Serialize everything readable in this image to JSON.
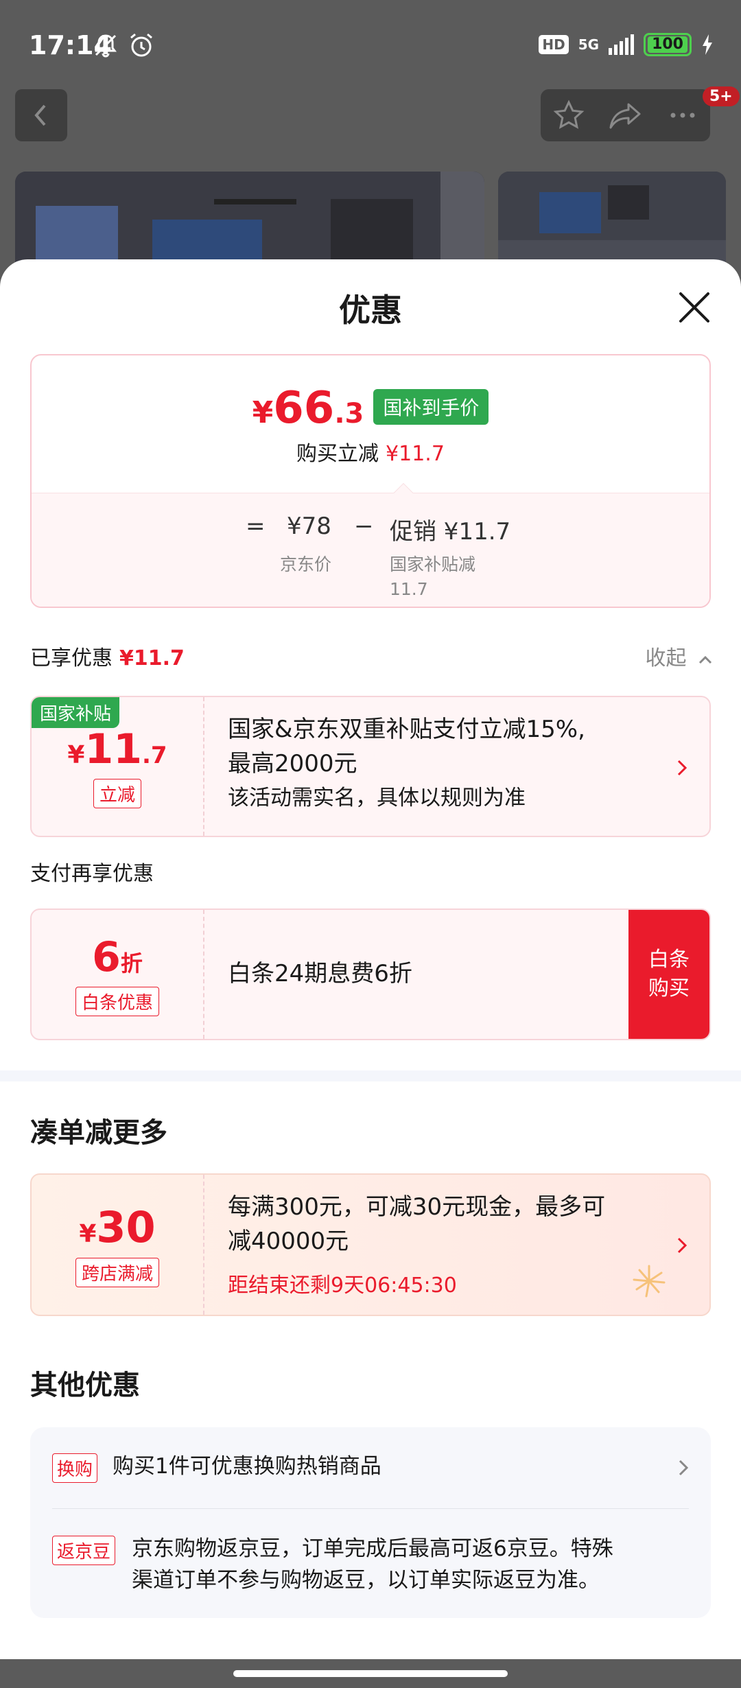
{
  "status_bar": {
    "time": "17:14",
    "hd": "HD",
    "network": "5G",
    "battery": "100"
  },
  "top_bar": {
    "cart_badge": "5+"
  },
  "sheet": {
    "title": "优惠",
    "price_card": {
      "yen": "¥",
      "final_int": "66",
      "final_dec": ".3",
      "final_tag": "国补到手价",
      "instant_label": "购买立减",
      "instant_value": "¥11.7",
      "equals": "=",
      "jd_price": "¥78",
      "minus": "−",
      "promo": "促销 ¥11.7",
      "jd_price_label": "京东价",
      "promo_label_line1": "国家补贴减",
      "promo_label_line2": "11.7"
    },
    "enjoyed": {
      "label": "已享优惠",
      "value": "¥11.7",
      "collapse": "收起"
    },
    "subsidy_coupon": {
      "corner_tag": "国家补贴",
      "yen": "¥",
      "amount_int": "11",
      "amount_dec": ".7",
      "chip": "立减",
      "line1": "国家&京东双重补贴支付立减15%,",
      "line2": "最高2000元",
      "line3": "该活动需实名，具体以规则为准"
    },
    "pay_more_label": "支付再享优惠",
    "baitiao_coupon": {
      "amount": "6",
      "unit": "折",
      "chip": "白条优惠",
      "desc": "白条24期息费6折",
      "button_line1": "白条",
      "button_line2": "购买"
    },
    "bundle_heading": "凑单减更多",
    "cross_store_coupon": {
      "yen": "¥",
      "amount": "30",
      "chip": "跨店满减",
      "line1": "每满300元，可减30元现金，最多可",
      "line2": "减40000元",
      "countdown": "距结束还剩9天06:45:30"
    },
    "other_heading": "其他优惠",
    "other_items": [
      {
        "tag": "换购",
        "text": "购买1件可优惠换购热销商品"
      },
      {
        "tag": "返京豆",
        "text_line1": "京东购物返京豆，订单完成后最高可返6京豆。特殊",
        "text_line2": "渠道订单不参与购物返豆，以订单实际返豆为准。"
      }
    ]
  },
  "colors": {
    "accent_red": "#ea1b2c",
    "subsidy_green": "#2fa84f",
    "overlay_gray": "#5b5b5b"
  }
}
